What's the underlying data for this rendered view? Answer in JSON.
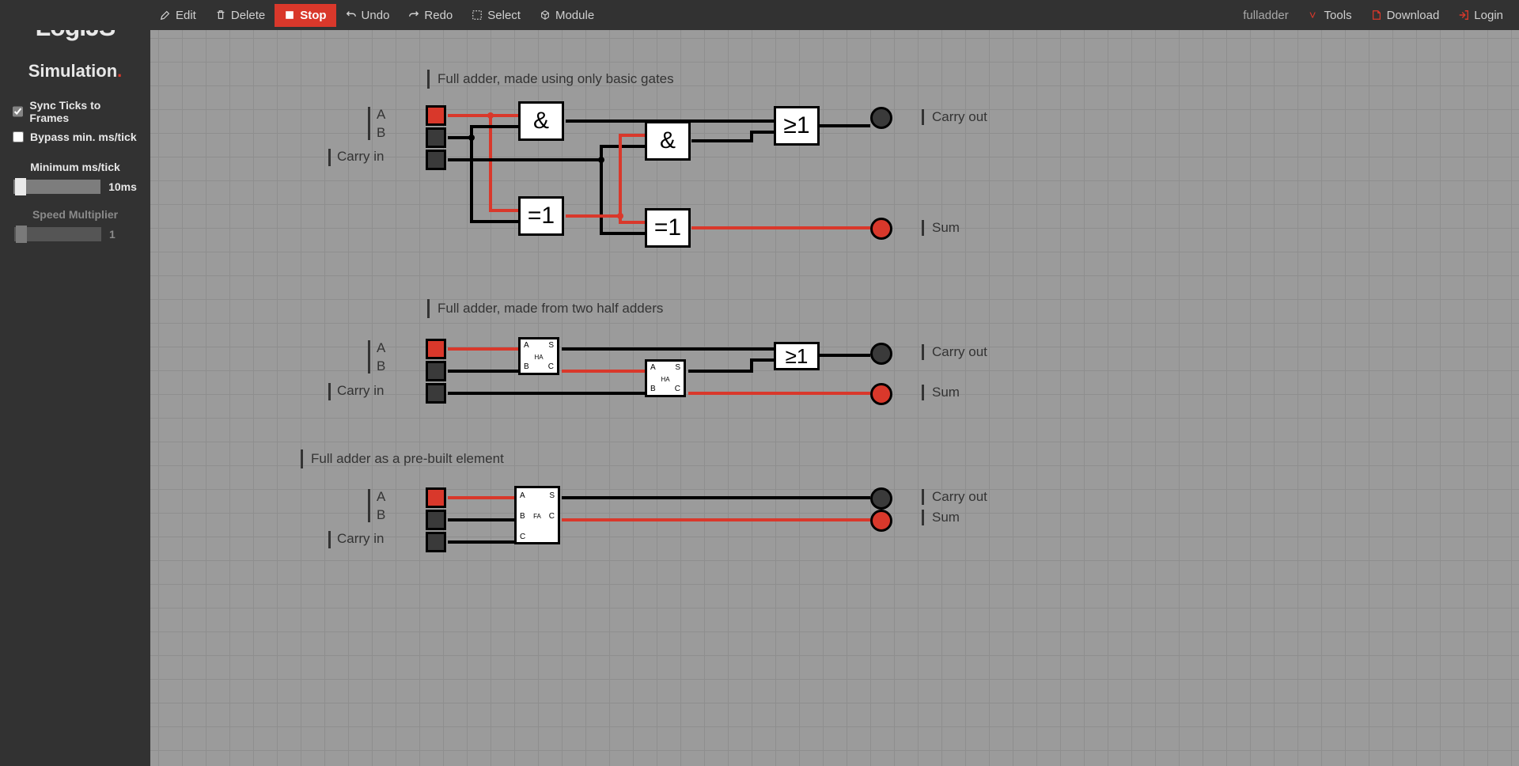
{
  "app": {
    "logo_main": "LogiJS",
    "sketch_name": "fulladder"
  },
  "topbar": {
    "edit": "Edit",
    "delete": "Delete",
    "stop": "Stop",
    "undo": "Undo",
    "redo": "Redo",
    "select": "Select",
    "module": "Module",
    "tools": "Tools",
    "download": "Download",
    "login": "Login"
  },
  "sidebar": {
    "title": "Simulation",
    "sync": "Sync Ticks to Frames",
    "sync_checked": true,
    "bypass": "Bypass min. ms/tick",
    "bypass_checked": false,
    "min_label": "Minimum ms/tick",
    "min_val": "10ms",
    "mult_label": "Speed Multiplier",
    "mult_val": "1"
  },
  "sections": [
    {
      "title": "Full adder, made using only basic gates",
      "inputs": [
        "A",
        "B",
        "Carry in"
      ],
      "outputs": [
        "Carry out",
        "Sum"
      ]
    },
    {
      "title": "Full adder, made from two half adders",
      "inputs": [
        "A",
        "B",
        "Carry in"
      ],
      "outputs": [
        "Carry out",
        "Sum"
      ]
    },
    {
      "title": "Full adder as a pre-built element",
      "inputs": [
        "A",
        "B",
        "Carry in"
      ],
      "outputs": [
        "Carry out",
        "Sum"
      ]
    }
  ],
  "gates": {
    "and": "&",
    "xor": "=1",
    "or": "≥1"
  },
  "ha": {
    "A": "A",
    "B": "B",
    "S": "S",
    "C": "C",
    "tag": "HA"
  },
  "fa": {
    "A": "A",
    "B": "B",
    "C": "C",
    "S": "S",
    "Cout": "C",
    "tag": "FA"
  },
  "colors": {
    "wire_hi": "#d9382b",
    "wire_lo": "#000000"
  },
  "switch_states": {
    "s1": [
      "on",
      "off",
      "off"
    ],
    "s2": [
      "on",
      "off",
      "off"
    ],
    "s3": [
      "on",
      "off",
      "off"
    ]
  },
  "lamp_states": {
    "s1": [
      "off",
      "on"
    ],
    "s2": [
      "off",
      "on"
    ],
    "s3": [
      "off",
      "on"
    ]
  }
}
